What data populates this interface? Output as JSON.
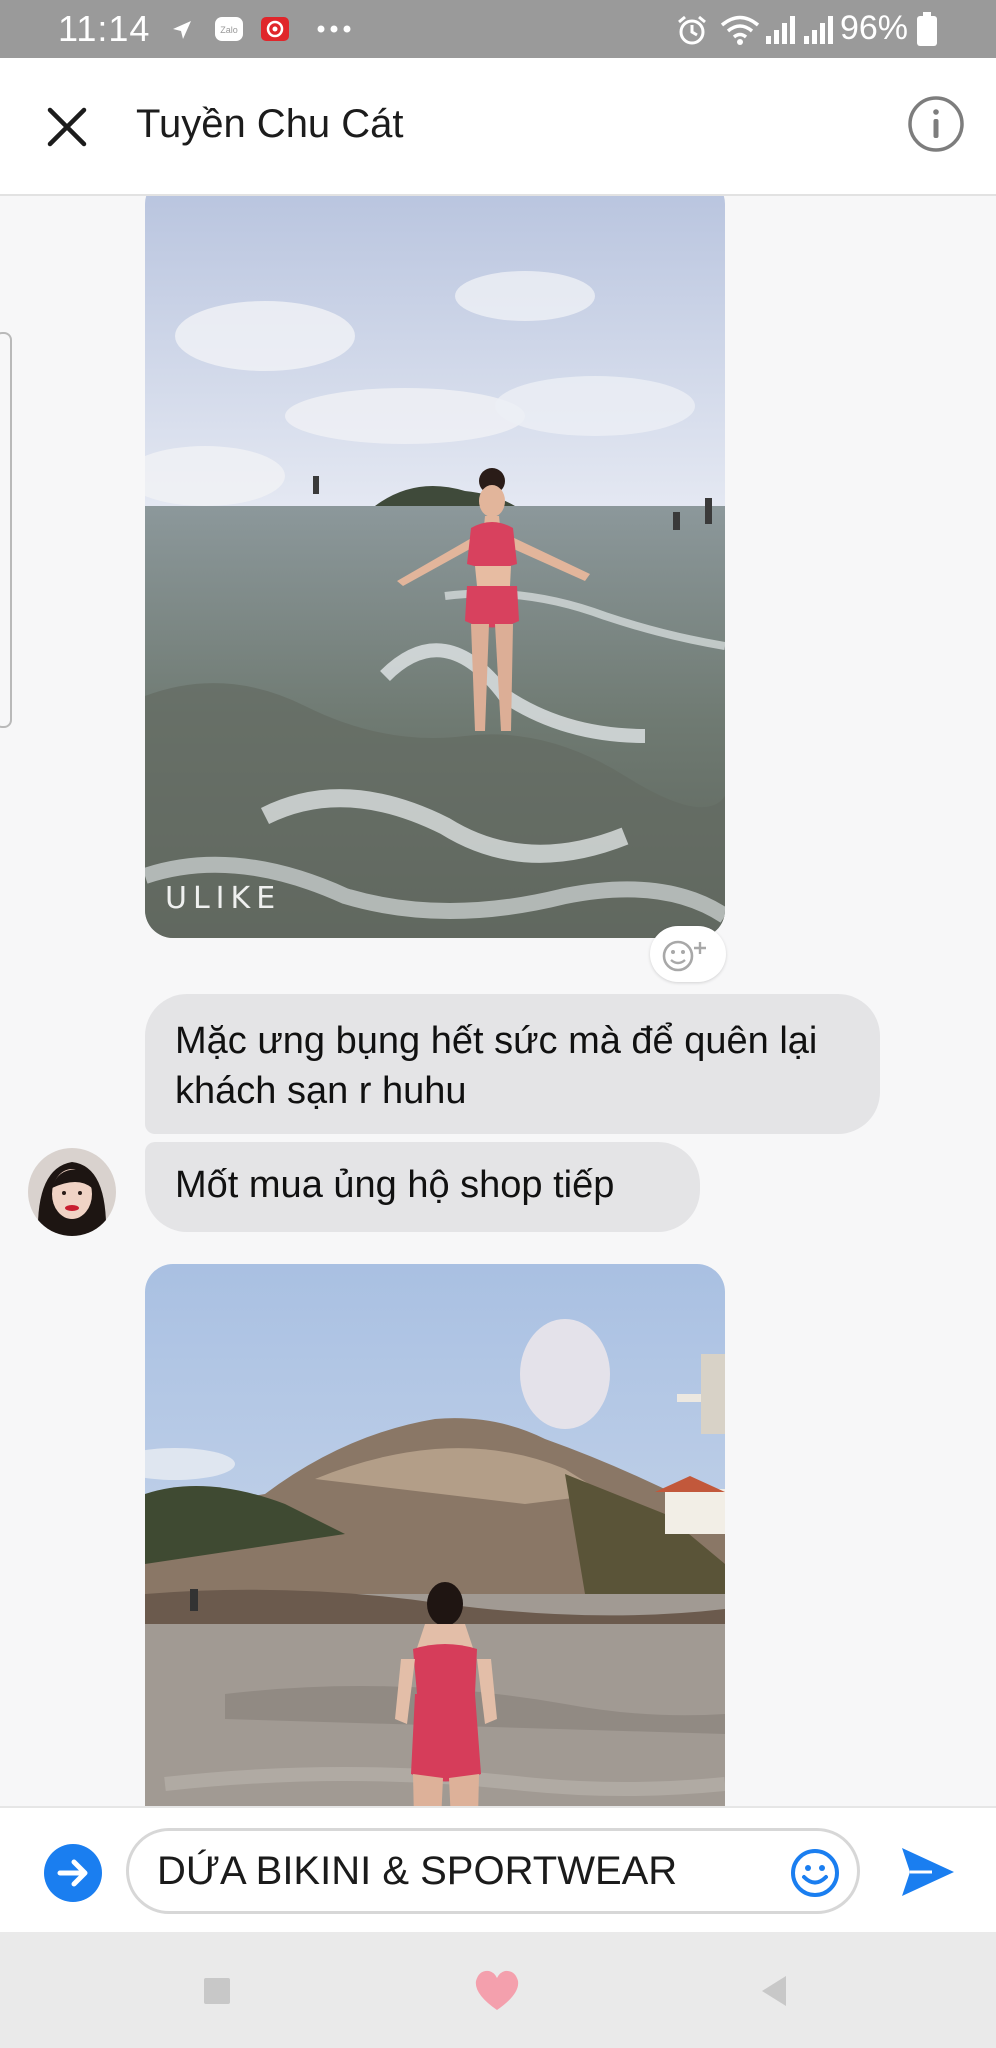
{
  "status_bar": {
    "time": "11:14",
    "battery": "96%",
    "icons": [
      "navigation-icon",
      "zalo-icon",
      "app-icon",
      "more-dots-icon",
      "alarm-icon",
      "wifi-icon",
      "signal-icon",
      "signal-icon",
      "battery-icon"
    ]
  },
  "header": {
    "title": "Tuyền Chu Cát",
    "close_icon": "close-icon",
    "info_icon": "info-icon"
  },
  "messages": [
    {
      "type": "photo",
      "watermark": "ULIKE"
    },
    {
      "type": "text",
      "text": "Mặc ưng bụng hết sức mà để quên lại khách sạn r huhu"
    },
    {
      "type": "text",
      "text": "Mốt mua ủng hộ shop tiếp"
    },
    {
      "type": "photo"
    }
  ],
  "composer": {
    "value": "DỨA BIKINI & SPORTWEAR",
    "expand_icon": "arrow-right-circle-icon",
    "emoji_icon": "emoji-icon",
    "send_icon": "send-icon"
  },
  "nav_bar": {
    "icons": [
      "recent-apps-icon",
      "home-heart-icon",
      "back-icon"
    ]
  },
  "colors": {
    "accent": "#1a7ef0",
    "bubble": "#e4e4e6",
    "status_bar": "#9a9a9a"
  }
}
